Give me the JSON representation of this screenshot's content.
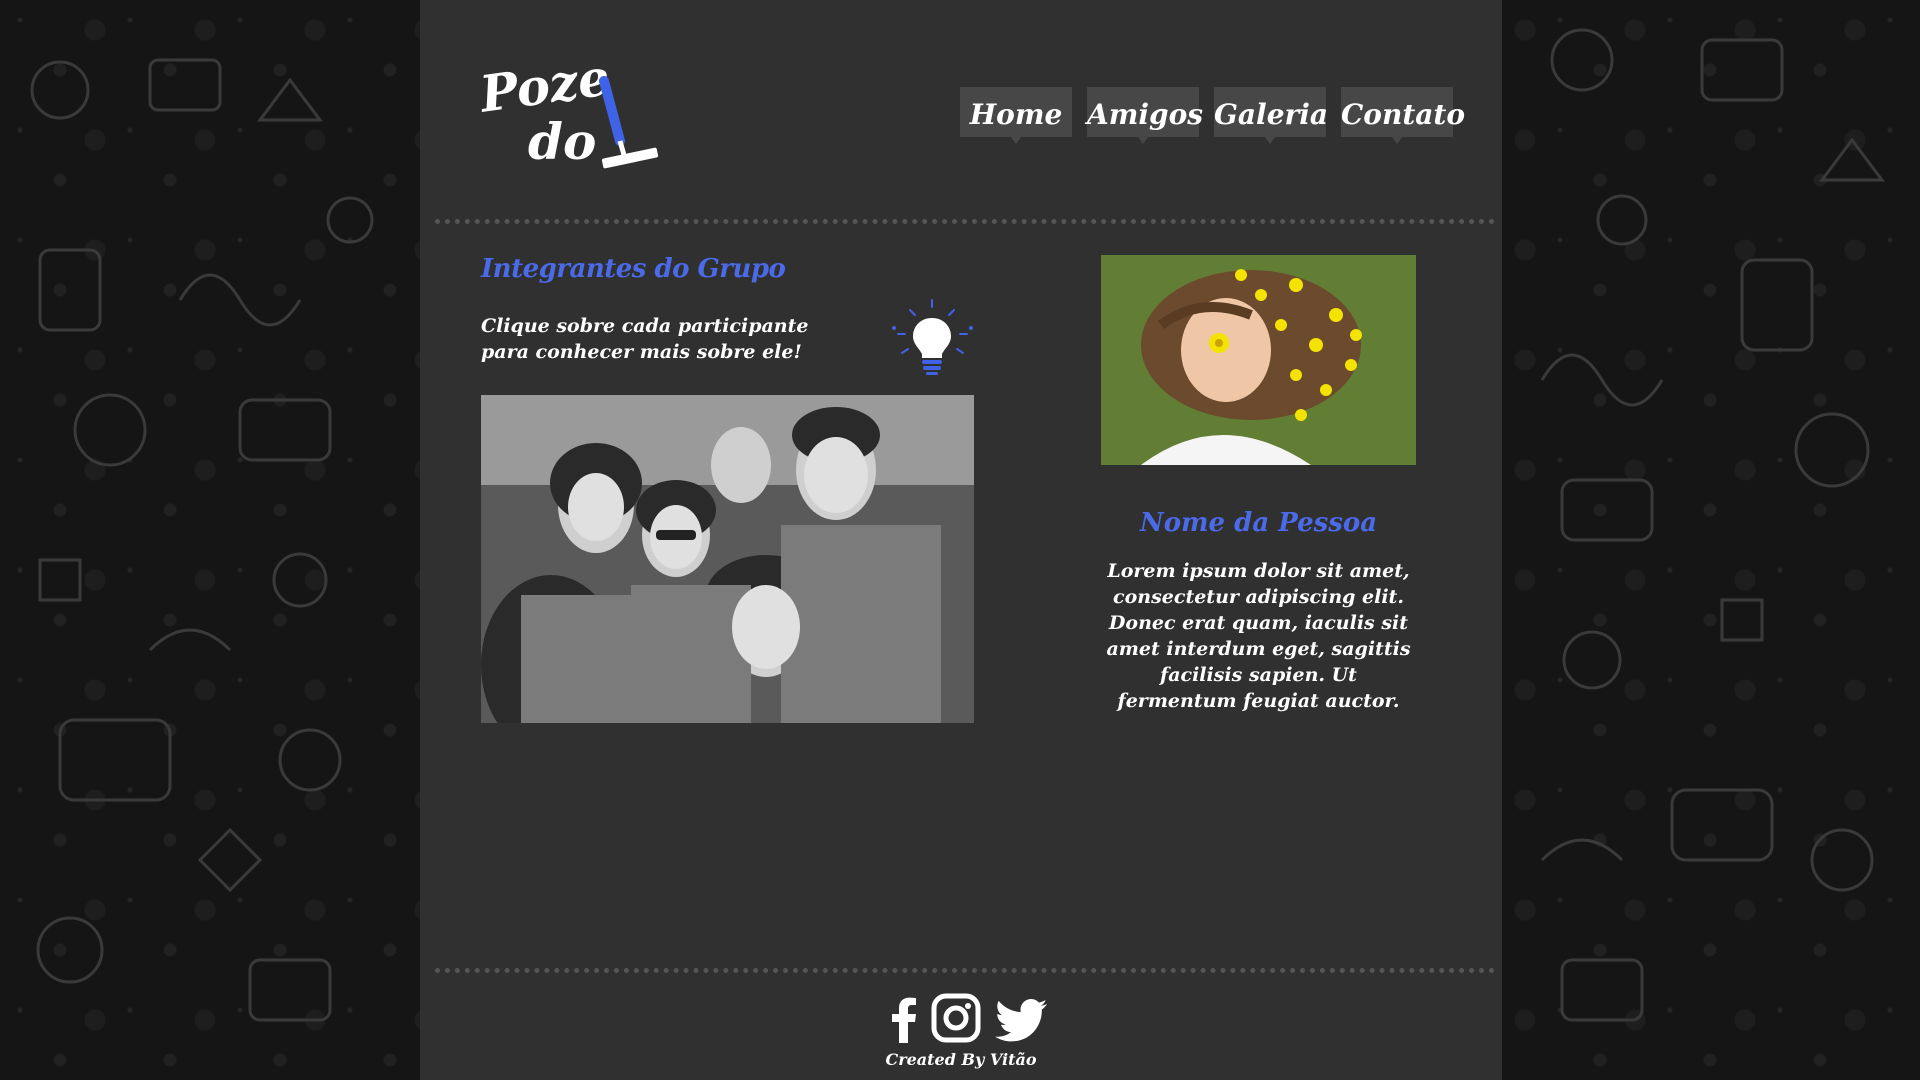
{
  "logo": {
    "line1": "Poze",
    "line2": "do",
    "icon": "squeegee-icon"
  },
  "nav": [
    {
      "label": "Home"
    },
    {
      "label": "Amigos"
    },
    {
      "label": "Galeria"
    },
    {
      "label": "Contato"
    }
  ],
  "main": {
    "title": "Integrantes do Grupo",
    "instructions": "Clique sobre cada participante para conhecer mais sobre ele!",
    "instructions_icon": "lightbulb-icon"
  },
  "person": {
    "name": "Nome da Pessoa",
    "description": "Lorem ipsum dolor sit amet, consectetur adipiscing elit. Donec erat quam, iaculis sit amet interdum eget, sagittis facilisis sapien. Ut fermentum feugiat auctor."
  },
  "footer": {
    "social_icons": [
      "facebook-icon",
      "instagram-icon",
      "twitter-icon"
    ],
    "credit": "Created By Vitão"
  },
  "colors": {
    "accent": "#4a6ae8",
    "page_bg": "#303030",
    "nav_bg": "#474747"
  }
}
